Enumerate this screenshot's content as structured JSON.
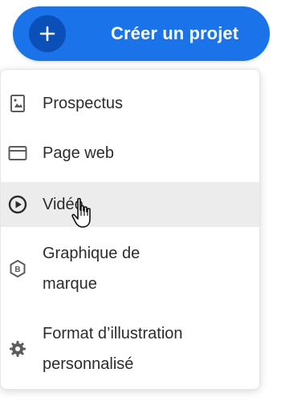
{
  "create_button": {
    "label": "Créer un projet",
    "icon": "plus-icon",
    "color": "#1a73e8"
  },
  "menu": {
    "items": [
      {
        "label": "Prospectus",
        "icon": "flyer-icon"
      },
      {
        "label": "Page web",
        "icon": "webpage-icon"
      },
      {
        "label": "Vidéo",
        "icon": "play-icon",
        "hovered": true
      },
      {
        "label": "Graphique de\nmarque",
        "icon": "brand-graphic-icon"
      },
      {
        "label": "Format d’illustration\npersonnalisé",
        "icon": "gear-icon"
      }
    ]
  },
  "cursor": {
    "type": "hand-pointer-icon"
  }
}
